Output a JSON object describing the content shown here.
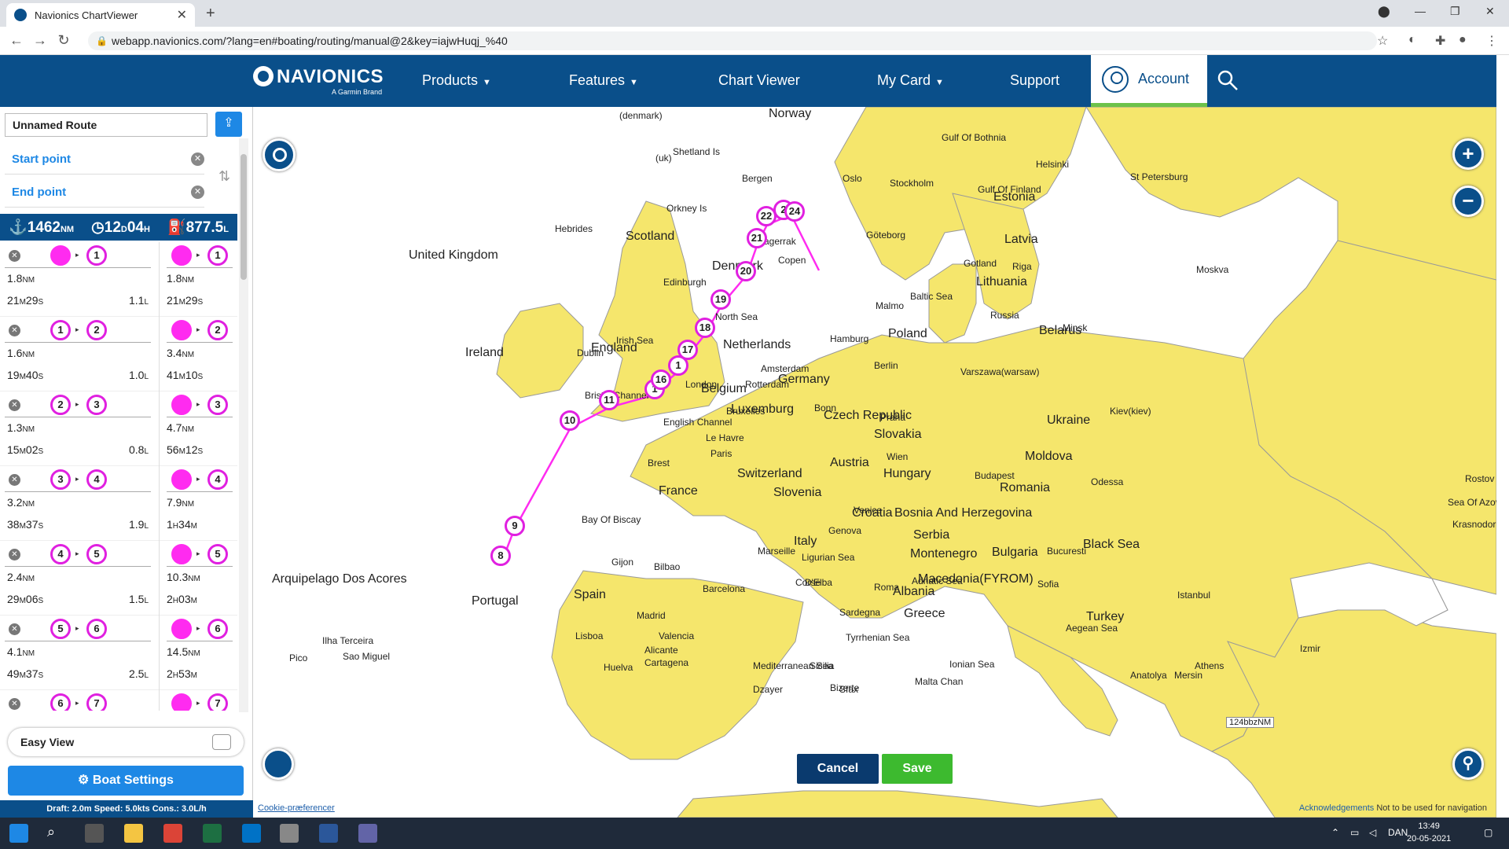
{
  "browser": {
    "tab_title": "Navionics ChartViewer",
    "url": "webapp.navionics.com/?lang=en#boating/routing/manual@2&key=iajwHuqj_%40"
  },
  "header": {
    "logo": "NAVIONICS",
    "logo_sub": "A Garmin Brand",
    "nav": [
      "Products",
      "Features",
      "Chart Viewer",
      "My Card",
      "Support"
    ],
    "account": "Account"
  },
  "route": {
    "name": "Unnamed Route",
    "start_label": "Start point",
    "end_label": "End point",
    "summary": {
      "distance": "1462",
      "distance_unit": "NM",
      "time_h": "12",
      "time_d": "D",
      "time_m": "04",
      "time_u": "H",
      "fuel": "877.5",
      "fuel_unit": "L"
    }
  },
  "legs": [
    {
      "from": "",
      "to": "1",
      "dist": "1.8",
      "dist_u": "NM",
      "time": "21",
      "time_u1": "M",
      "time2": "29",
      "time_u2": "S",
      "fuel": "1.1",
      "fuel_u": "L",
      "cum_to": "1",
      "cum_dist": "1.8",
      "cum_time": "21",
      "cum_t1": "M",
      "cum_time2": "29",
      "cum_t2": "S"
    },
    {
      "from": "1",
      "to": "2",
      "dist": "1.6",
      "dist_u": "NM",
      "time": "19",
      "time_u1": "M",
      "time2": "40",
      "time_u2": "S",
      "fuel": "1.0",
      "fuel_u": "L",
      "cum_to": "2",
      "cum_dist": "3.4",
      "cum_time": "41",
      "cum_t1": "M",
      "cum_time2": "10",
      "cum_t2": "S"
    },
    {
      "from": "2",
      "to": "3",
      "dist": "1.3",
      "dist_u": "NM",
      "time": "15",
      "time_u1": "M",
      "time2": "02",
      "time_u2": "S",
      "fuel": "0.8",
      "fuel_u": "L",
      "cum_to": "3",
      "cum_dist": "4.7",
      "cum_time": "56",
      "cum_t1": "M",
      "cum_time2": "12",
      "cum_t2": "S"
    },
    {
      "from": "3",
      "to": "4",
      "dist": "3.2",
      "dist_u": "NM",
      "time": "38",
      "time_u1": "M",
      "time2": "37",
      "time_u2": "S",
      "fuel": "1.9",
      "fuel_u": "L",
      "cum_to": "4",
      "cum_dist": "7.9",
      "cum_time": "1",
      "cum_t1": "H",
      "cum_time2": "34",
      "cum_t2": "M"
    },
    {
      "from": "4",
      "to": "5",
      "dist": "2.4",
      "dist_u": "NM",
      "time": "29",
      "time_u1": "M",
      "time2": "06",
      "time_u2": "S",
      "fuel": "1.5",
      "fuel_u": "L",
      "cum_to": "5",
      "cum_dist": "10.3",
      "cum_time": "2",
      "cum_t1": "H",
      "cum_time2": "03",
      "cum_t2": "M"
    },
    {
      "from": "5",
      "to": "6",
      "dist": "4.1",
      "dist_u": "NM",
      "time": "49",
      "time_u1": "M",
      "time2": "37",
      "time_u2": "S",
      "fuel": "2.5",
      "fuel_u": "L",
      "cum_to": "6",
      "cum_dist": "14.5",
      "cum_time": "2",
      "cum_t1": "H",
      "cum_time2": "53",
      "cum_t2": "M"
    },
    {
      "from": "6",
      "to": "7",
      "dist": "",
      "dist_u": "",
      "time": "",
      "time_u1": "",
      "time2": "",
      "time_u2": "",
      "fuel": "",
      "fuel_u": "",
      "cum_to": "7",
      "cum_dist": "",
      "cum_time": "",
      "cum_t1": "",
      "cum_time2": "",
      "cum_t2": ""
    }
  ],
  "easy_view": "Easy View",
  "boat_settings": "Boat Settings",
  "boat_info": "Draft: 2.0m Speed: 5.0kts Cons.: 3.0L/h",
  "map": {
    "cancel": "Cancel",
    "save": "Save",
    "scale": "124bbzNM",
    "cookie": "Cookie-præferencer",
    "ack": "Acknowledgements",
    "ack_note": "Not to be used for navigation",
    "countries": [
      "Norway",
      "United Kingdom",
      "Scotland",
      "Denmark",
      "Estonia",
      "Latvia",
      "Lithuania",
      "Belarus",
      "Poland",
      "Ireland",
      "England",
      "Netherlands",
      "Germany",
      "Belgium",
      "Luxemburg",
      "Czech Republic",
      "Ukraine",
      "Slovakia",
      "Moldova",
      "Austria",
      "Hungary",
      "Switzerland",
      "France",
      "Romania",
      "Slovenia",
      "Croatia",
      "Bosnia And Herzegovina",
      "Serbia",
      "Black Sea",
      "Italy",
      "Montenegro",
      "Bulgaria",
      "Macedonia(FYROM)",
      "Albania",
      "Spain",
      "Portugal",
      "Greece",
      "Turkey",
      "Arquipelago Dos Acores"
    ],
    "places": [
      "(denmark)",
      "Shetland Is",
      "(uk)",
      "Bergen",
      "Oslo",
      "Stockholm",
      "Gulf Of Bothnia",
      "Helsinki",
      "Gulf Of Finland",
      "St Petersburg",
      "Orkney Is",
      "Hebrides",
      "Skagerrak",
      "Göteborg",
      "Gotland",
      "Riga",
      "Moskva",
      "Edinburgh",
      "Copen",
      "Malmo",
      "Baltic Sea",
      "North Sea",
      "Russia",
      "Minsk",
      "Irish Sea",
      "Hamburg",
      "Dublin",
      "Amsterdam",
      "Berlin",
      "Varszawa(warsaw)",
      "Rotterdam",
      "Bristol Channel",
      "London",
      "Bruxelles",
      "Bonn",
      "Praha",
      "Kiev(kiev)",
      "English Channel",
      "Le Havre",
      "Paris",
      "Wien",
      "Brest",
      "Budapest",
      "Odessa",
      "Rostov",
      "Sea Of Azov",
      "Bay Of Biscay",
      "Venice",
      "Genova",
      "Krasnodor",
      "Marseille",
      "Bucuresti",
      "Gijon",
      "Bilbao",
      "Ligurian Sea",
      "Corse",
      "Adriatic Sea",
      "Sofia",
      "Istanbul",
      "Barcelona",
      "Roma",
      "Madrid",
      "Sardegna",
      "Valencia",
      "Ilha Terceira",
      "Tyrrhenian Sea",
      "Aegean Sea",
      "Lisboa",
      "Alicante",
      "Pico",
      "Sao Miguel",
      "Cartagena",
      "Izmir",
      "Huelva",
      "Mediterranean Sea",
      "Sicilia",
      "Ionian Sea",
      "Athens",
      "Anatolya",
      "Mersin",
      "Malta Chan",
      "Bizerte",
      "Sfax",
      "Dzayer",
      "D'Elba"
    ],
    "waypoints": [
      "8",
      "9",
      "10",
      "11",
      "1",
      "16",
      "1",
      "17",
      "18",
      "19",
      "20",
      "21",
      "22",
      "2",
      "24"
    ]
  },
  "taskbar": {
    "lang": "DAN",
    "time": "13:49",
    "date": "20-05-2021"
  }
}
